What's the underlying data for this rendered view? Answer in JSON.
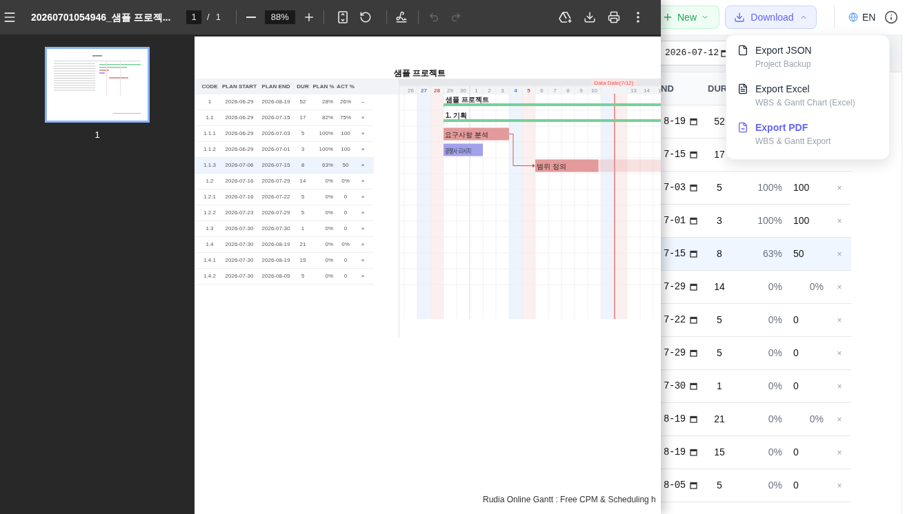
{
  "viewer": {
    "title": "20260701054946_샘플 프로젝...",
    "page": "1",
    "page_separator": "/",
    "page_count": "1",
    "zoom": "88%",
    "undo": {
      "disabled": true
    },
    "redo": {
      "disabled": true
    },
    "thumbnail_label": "1"
  },
  "document": {
    "title": "샘플 프로젝트",
    "table": {
      "columns": [
        "CODE",
        "PLAN START",
        "PLAN END",
        "DUR",
        "PLAN %",
        "ACT %"
      ],
      "rows": [
        {
          "code": "1",
          "plan_start": "2026-06-29",
          "plan_end": "2026-08-19",
          "dur": "52",
          "plan": "28%",
          "act": "26%",
          "action": "–",
          "selected": false,
          "bar": {
            "label": "샘플 프로젝트",
            "kind": "summary",
            "color": "#74d19b"
          }
        },
        {
          "code": "1.1",
          "plan_start": "2026-06-29",
          "plan_end": "2026-07-15",
          "dur": "17",
          "plan": "82%",
          "act": "75%",
          "action": "×",
          "selected": false,
          "bar": {
            "label": "1. 기획",
            "kind": "summary",
            "color": "#74d19b"
          }
        },
        {
          "code": "1.1.1",
          "plan_start": "2026-06-29",
          "plan_end": "2026-07-03",
          "dur": "5",
          "plan": "100%",
          "act": "100",
          "action": "×",
          "selected": false,
          "bar": {
            "label": "요구사항 분석",
            "kind": "task",
            "color": "#e49a9a",
            "level": 1
          }
        },
        {
          "code": "1.1.2",
          "plan_start": "2026-06-29",
          "plan_end": "2026-07-01",
          "dur": "3",
          "plan": "100%",
          "act": "100",
          "action": "×",
          "selected": false,
          "bar": {
            "label": "경쟁사 리서치",
            "kind": "task",
            "color": "#a3a1ec",
            "level": 1
          }
        },
        {
          "code": "1.1.3",
          "plan_start": "2026-07-06",
          "plan_end": "2026-07-15",
          "dur": "8",
          "plan": "63%",
          "act": "50",
          "action": "×",
          "selected": true,
          "bar": {
            "label": "범위 정의",
            "kind": "task",
            "color": "#e49a9a",
            "level": 0.5
          }
        },
        {
          "code": "1.2",
          "plan_start": "2026-07-16",
          "plan_end": "2026-07-29",
          "dur": "14",
          "plan": "0%",
          "act": "0%",
          "action": "×",
          "selected": false
        },
        {
          "code": "1.2.1",
          "plan_start": "2026-07-16",
          "plan_end": "2026-07-22",
          "dur": "5",
          "plan": "0%",
          "act": "0",
          "action": "×",
          "selected": false
        },
        {
          "code": "1.2.2",
          "plan_start": "2026-07-23",
          "plan_end": "2026-07-29",
          "dur": "5",
          "plan": "0%",
          "act": "0",
          "action": "×",
          "selected": false
        },
        {
          "code": "1.3",
          "plan_start": "2026-07-30",
          "plan_end": "2026-07-30",
          "dur": "1",
          "plan": "0%",
          "act": "0",
          "action": "×",
          "selected": false
        },
        {
          "code": "1.4",
          "plan_start": "2026-07-30",
          "plan_end": "2026-08-19",
          "dur": "21",
          "plan": "0%",
          "act": "0%",
          "action": "×",
          "selected": false
        },
        {
          "code": "1.4.1",
          "plan_start": "2026-07-30",
          "plan_end": "2026-08-19",
          "dur": "15",
          "plan": "0%",
          "act": "0",
          "action": "×",
          "selected": false
        },
        {
          "code": "1.4.2",
          "plan_start": "2026-07-30",
          "plan_end": "2026-08-05",
          "dur": "5",
          "plan": "0%",
          "act": "0",
          "action": "×",
          "selected": false
        }
      ]
    },
    "timeline": {
      "days": [
        {
          "label": "26",
          "kind": "weekday"
        },
        {
          "label": "27",
          "kind": "saturday"
        },
        {
          "label": "28",
          "kind": "sunday"
        },
        {
          "label": "29",
          "kind": "weekday"
        },
        {
          "label": "30",
          "kind": "weekday"
        },
        {
          "label": "1",
          "kind": "month_start"
        },
        {
          "label": "2",
          "kind": "weekday"
        },
        {
          "label": "3",
          "kind": "weekday"
        },
        {
          "label": "4",
          "kind": "saturday"
        },
        {
          "label": "5",
          "kind": "sunday"
        },
        {
          "label": "6",
          "kind": "weekday"
        },
        {
          "label": "7",
          "kind": "weekday"
        },
        {
          "label": "8",
          "kind": "weekday"
        },
        {
          "label": "9",
          "kind": "weekday"
        },
        {
          "label": "10",
          "kind": "weekday"
        },
        {
          "label": "Data Date(7/12)",
          "kind": "data_date"
        },
        {
          "label": "13",
          "kind": "weekday"
        },
        {
          "label": "14",
          "kind": "weekday"
        },
        {
          "label": "1",
          "kind": "weekday"
        }
      ]
    },
    "footer": "Rudia Online Gantt : Free CPM & Scheduling h"
  },
  "app": {
    "new_button": "New",
    "download_button": {
      "label": "Download",
      "expanded": true
    },
    "language": "EN",
    "download_menu": [
      {
        "kind": "json",
        "label": "Export JSON",
        "description": "Project Backup",
        "selected": false
      },
      {
        "kind": "excel",
        "label": "Export Excel",
        "description": "WBS & Gantt Chart (Excel)",
        "selected": false
      },
      {
        "kind": "pdf",
        "label": "Export PDF",
        "description": "WBS & Gantt Export",
        "selected": true
      }
    ],
    "data_date": "2026-07-12",
    "table": {
      "columns": [
        "ND",
        "DUR"
      ],
      "rows": [
        {
          "end": "8-19",
          "dur": "52",
          "selected": false
        },
        {
          "end": "7-15",
          "dur": "17",
          "selected": false
        },
        {
          "end": "7-03",
          "dur": "5",
          "plan": "100%",
          "act": {
            "kind": "input",
            "value": "100"
          },
          "action": "×",
          "selected": false
        },
        {
          "end": "7-01",
          "dur": "3",
          "plan": "100%",
          "act": {
            "kind": "input",
            "value": "100"
          },
          "action": "×",
          "selected": false
        },
        {
          "end": "7-15",
          "dur": "8",
          "plan": "63%",
          "act": {
            "kind": "input",
            "value": "50"
          },
          "action": "×",
          "selected": true
        },
        {
          "end": "7-29",
          "dur": "14",
          "plan": "0%",
          "act": {
            "kind": "summary",
            "value": "0%"
          },
          "action": "×",
          "selected": false
        },
        {
          "end": "7-22",
          "dur": "5",
          "plan": "0%",
          "act": {
            "kind": "input",
            "value": "0"
          },
          "action": "×",
          "selected": false
        },
        {
          "end": "7-29",
          "dur": "5",
          "plan": "0%",
          "act": {
            "kind": "input",
            "value": "0"
          },
          "action": "×",
          "selected": false
        },
        {
          "end": "7-30",
          "dur": "1",
          "plan": "0%",
          "act": {
            "kind": "input",
            "value": "0"
          },
          "action": "×",
          "selected": false
        },
        {
          "end": "8-19",
          "dur": "21",
          "plan": "0%",
          "act": {
            "kind": "summary",
            "value": "0%"
          },
          "action": "×",
          "selected": false
        },
        {
          "end": "8-19",
          "dur": "15",
          "plan": "0%",
          "act": {
            "kind": "input",
            "value": "0"
          },
          "action": "×",
          "selected": false
        },
        {
          "end": "8-05",
          "dur": "5",
          "plan": "0%",
          "act": {
            "kind": "input",
            "value": "0"
          },
          "action": "×",
          "selected": false
        }
      ]
    }
  }
}
